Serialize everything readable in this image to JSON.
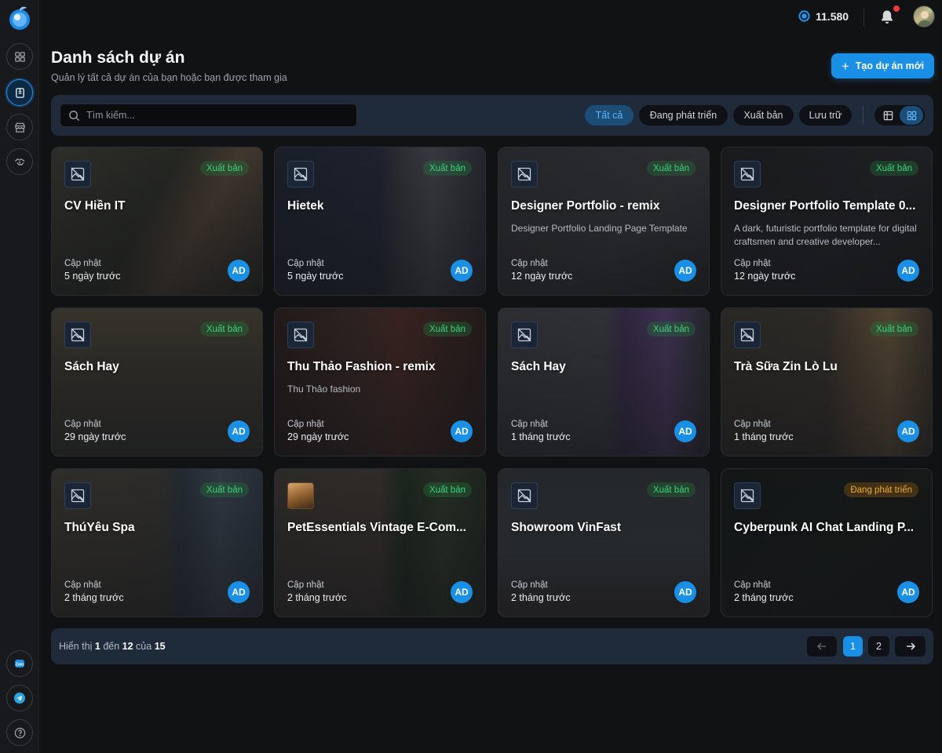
{
  "topbar": {
    "credits": "11.580"
  },
  "header": {
    "title": "Danh sách dự án",
    "subtitle": "Quản lý tất cả dự án của bạn hoặc bạn được tham gia",
    "new_button": "Tạo dự án mới"
  },
  "filters": {
    "search_placeholder": "Tìm kiếm...",
    "chips": [
      "Tất cả",
      "Đang phát triển",
      "Xuất bản",
      "Lưu trữ"
    ],
    "active_chip": "Tất cả",
    "view_mode": "grid"
  },
  "update_label": "Cập nhật",
  "owner_initials": "AD",
  "projects": [
    {
      "title": "CV Hiền IT",
      "desc": "",
      "status": "Xuất bản",
      "updated": "5 ngày trước"
    },
    {
      "title": "Hietek",
      "desc": "",
      "status": "Xuất bản",
      "updated": "5 ngày trước"
    },
    {
      "title": "Designer Portfolio - remix",
      "desc": "Designer Portfolio Landing Page Template",
      "status": "Xuất bản",
      "updated": "12 ngày trước"
    },
    {
      "title": "Designer Portfolio Template 0...",
      "desc": "A dark, futuristic portfolio template for digital craftsmen and creative developer...",
      "status": "Xuất bản",
      "updated": "12 ngày trước"
    },
    {
      "title": "Sách Hay",
      "desc": "",
      "status": "Xuất bản",
      "updated": "29 ngày trước"
    },
    {
      "title": "Thu Thảo Fashion - remix",
      "desc": "Thu Thảo fashion",
      "status": "Xuất bản",
      "updated": "29 ngày trước"
    },
    {
      "title": "Sách Hay",
      "desc": "",
      "status": "Xuất bản",
      "updated": "1 tháng trước"
    },
    {
      "title": "Trà Sữa Zin Lò Lu",
      "desc": "",
      "status": "Xuất bản",
      "updated": "1 tháng trước"
    },
    {
      "title": "ThúYêu Spa",
      "desc": "",
      "status": "Xuất bản",
      "updated": "2 tháng trước"
    },
    {
      "title": "PetEssentials Vintage E-Com...",
      "desc": "",
      "status": "Xuất bản",
      "updated": "2 tháng trước"
    },
    {
      "title": "Showroom VinFast",
      "desc": "",
      "status": "Xuất bản",
      "updated": "2 tháng trước"
    },
    {
      "title": "Cyberpunk AI Chat Landing P...",
      "desc": "",
      "status": "Đang phát triển",
      "updated": "2 tháng trước"
    }
  ],
  "pagination": {
    "prefix": "Hiển thị",
    "from": "1",
    "to_word": "đến",
    "to": "12",
    "of_word": "của",
    "total": "15",
    "pages": [
      "1",
      "2"
    ],
    "current": "1"
  },
  "colors": {
    "accent": "#1a8fe6",
    "published": "#3ed27a",
    "developing": "#f0a92e",
    "background": "#111214"
  }
}
